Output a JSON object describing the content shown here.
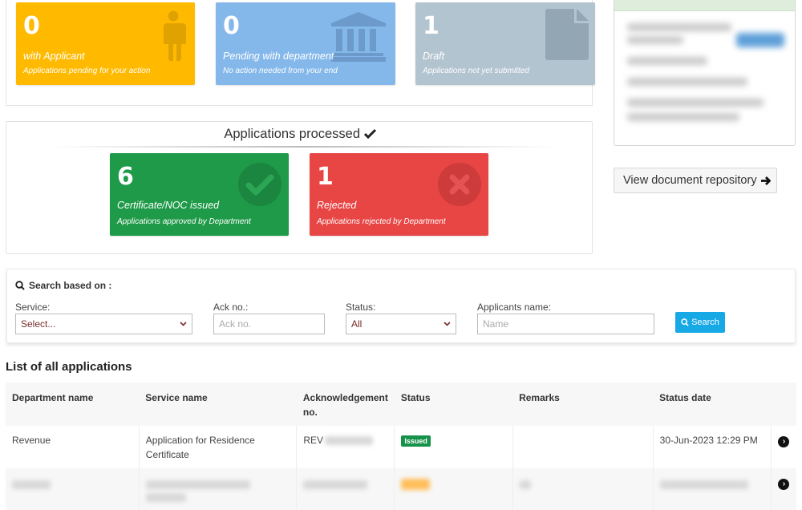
{
  "status_cards": {
    "with_applicant": {
      "count": "0",
      "title": "with Applicant",
      "subtitle": "Applications pending for your action",
      "icon": "person-icon",
      "color": "#ffba00"
    },
    "pending_department": {
      "count": "0",
      "title": "Pending with department",
      "subtitle": "No action needed from your end",
      "icon": "bank-icon",
      "color": "#85b8ea"
    },
    "draft": {
      "count": "1",
      "title": "Draft",
      "subtitle": "Applications not yet submitted",
      "icon": "file-icon",
      "color": "#b2c4d0"
    }
  },
  "processed": {
    "heading": "Applications processed",
    "heading_icon": "check-icon",
    "issued": {
      "count": "6",
      "title": "Certificate/NOC issued",
      "subtitle": "Applications approved by Department",
      "icon": "check-circle-icon",
      "color": "#1f9a48"
    },
    "rejected": {
      "count": "1",
      "title": "Rejected",
      "subtitle": "Applications rejected by Department",
      "icon": "times-circle-icon",
      "color": "#e84545"
    }
  },
  "side": {
    "doc_repo_button": "View document repository",
    "doc_repo_icon": "arrow-right-icon"
  },
  "search": {
    "heading": "Search based on :",
    "service_label": "Service:",
    "service_value": "Select...",
    "ack_label": "Ack no.:",
    "ack_placeholder": "Ack no.",
    "status_label": "Status:",
    "status_value": "All",
    "name_label": "Applicants name:",
    "name_placeholder": "Name",
    "button_label": "Search"
  },
  "list": {
    "title": "List of all applications",
    "columns": [
      "Department name",
      "Service name",
      "Acknowledgement no.",
      "Status",
      "Remarks",
      "Status date"
    ],
    "rows": [
      {
        "department": "Revenue",
        "service": "Application for Residence Certificate",
        "ack_prefix": "REV",
        "status": "Issued",
        "remarks": "",
        "status_date": "30-Jun-2023 12:29 PM"
      }
    ]
  },
  "colors": {
    "search_button": "#17a8e6",
    "issued_badge": "#17924a"
  }
}
